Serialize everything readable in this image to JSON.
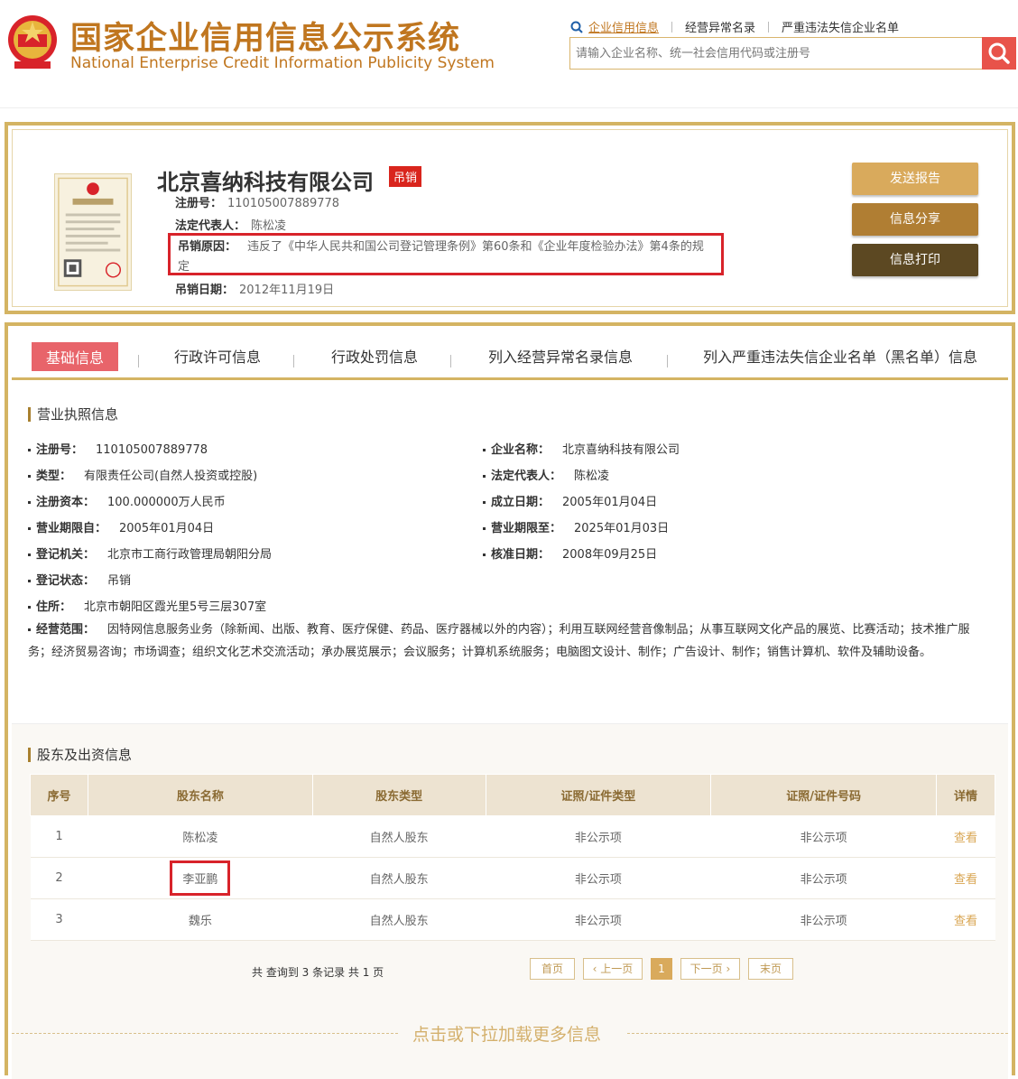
{
  "header": {
    "title_cn": "国家企业信用信息公示系统",
    "title_en": "National Enterprise Credit Information Publicity System",
    "nav": [
      "企业信用信息",
      "经营异常名录",
      "严重违法失信企业名单"
    ],
    "search_placeholder": "请输入企业名称、统一社会信用代码或注册号"
  },
  "company": {
    "name": "北京喜纳科技有限公司",
    "status_tag": "吊销",
    "reg_no_label": "注册号：",
    "reg_no": "110105007889778",
    "legal_rep_label": "法定代表人：",
    "legal_rep": "陈松凌",
    "revoke_reason_label": "吊销原因：",
    "revoke_reason": "违反了《中华人民共和国公司登记管理条例》第60条和《企业年度检验办法》第4条的规定",
    "revoke_date_label": "吊销日期：",
    "revoke_date": "2012年11月19日"
  },
  "actions": {
    "send": "发送报告",
    "share": "信息分享",
    "print": "信息打印"
  },
  "tabs": [
    "基础信息",
    "行政许可信息",
    "行政处罚信息",
    "列入经营异常名录信息",
    "列入严重违法失信企业名单（黑名单）信息"
  ],
  "license_section": {
    "title": "营业执照信息",
    "reg_no": {
      "label": "注册号：",
      "value": "110105007889778"
    },
    "company_name": {
      "label": "企业名称：",
      "value": "北京喜纳科技有限公司"
    },
    "type": {
      "label": "类型：",
      "value": "有限责任公司(自然人投资或控股)"
    },
    "legal_rep": {
      "label": "法定代表人：",
      "value": "陈松凌"
    },
    "capital": {
      "label": "注册资本：",
      "value": "100.000000万人民币"
    },
    "established": {
      "label": "成立日期：",
      "value": "2005年01月04日"
    },
    "term_from": {
      "label": "营业期限自：",
      "value": "2005年01月04日"
    },
    "term_to": {
      "label": "营业期限至：",
      "value": "2025年01月03日"
    },
    "authority": {
      "label": "登记机关：",
      "value": "北京市工商行政管理局朝阳分局"
    },
    "approved": {
      "label": "核准日期：",
      "value": "2008年09月25日"
    },
    "reg_status": {
      "label": "登记状态：",
      "value": "吊销"
    },
    "address": {
      "label": "住所：",
      "value": "北京市朝阳区霞光里5号三层307室"
    },
    "scope": {
      "label": "经营范围：",
      "value": "因特网信息服务业务（除新闻、出版、教育、医疗保健、药品、医疗器械以外的内容）；利用互联网经营音像制品；从事互联网文化产品的展览、比赛活动；技术推广服务；经济贸易咨询；市场调查；组织文化艺术交流活动；承办展览展示；会议服务；计算机系统服务；电脑图文设计、制作；广告设计、制作；销售计算机、软件及辅助设备。"
    }
  },
  "shareholders": {
    "title": "股东及出资信息",
    "columns": [
      "序号",
      "股东名称",
      "股东类型",
      "证照/证件类型",
      "证照/证件号码",
      "详情"
    ],
    "rows": [
      [
        "1",
        "陈松凌",
        "自然人股东",
        "非公示项",
        "非公示项",
        "查看"
      ],
      [
        "2",
        "李亚鹏",
        "自然人股东",
        "非公示项",
        "非公示项",
        "查看"
      ],
      [
        "3",
        "魏乐",
        "自然人股东",
        "非公示项",
        "非公示项",
        "查看"
      ]
    ],
    "pager_info": "共 查询到 3 条记录 共 1 页",
    "pager": {
      "first": "首页",
      "prev": "上一页",
      "current": "1",
      "next": "下一页",
      "last": "末页"
    }
  },
  "load_more": "点击或下拉加载更多信息",
  "colors": {
    "gold": "#d4b463",
    "accent": "#c0761f",
    "red": "#d8232a",
    "tab_active": "#e8646a"
  }
}
